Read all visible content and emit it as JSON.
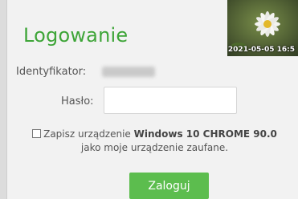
{
  "login": {
    "title": "Logowanie",
    "photo_timestamp": "2021-05-05 16:5",
    "identifier_label": "Identyfikator:",
    "password_label": "Hasło:",
    "password_value": "",
    "remember_prefix": "Zapisz urządzenie",
    "remember_device": "Windows 10 CHROME 90.0",
    "remember_suffix": "jako moje urządzenie zaufane.",
    "submit_label": "Zaloguj"
  },
  "colors": {
    "title": "#3ea538",
    "button": "#5cbd4e",
    "panel_bg": "#f2f2f2"
  },
  "icons": {
    "photo": "daisy-flower-photo",
    "checkbox": "checkbox-unchecked"
  }
}
